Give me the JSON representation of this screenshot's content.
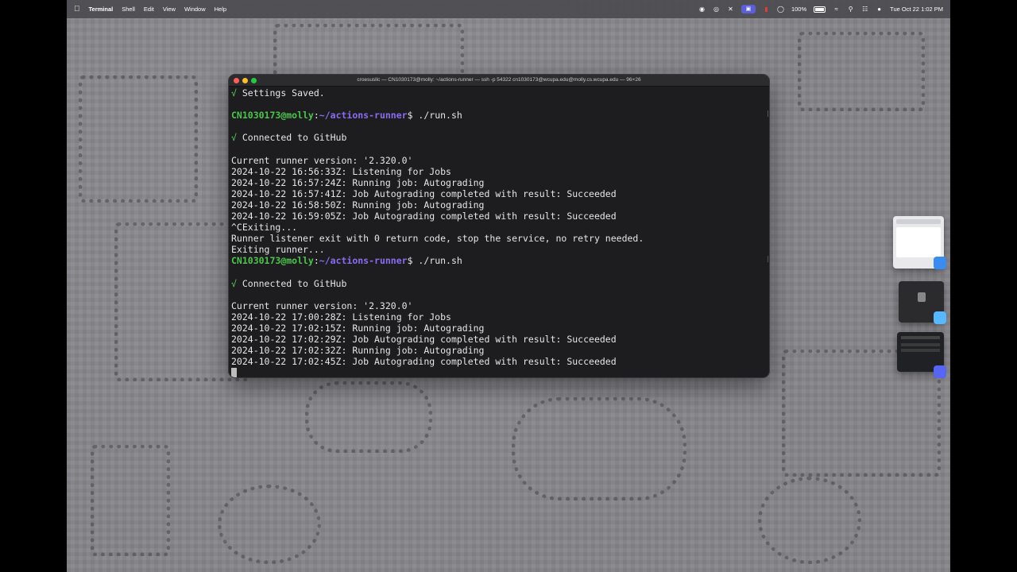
{
  "menubar": {
    "app": "Terminal",
    "items": [
      "Shell",
      "Edit",
      "View",
      "Window",
      "Help"
    ],
    "battery": "100%",
    "datetime": "Tue Oct 22  1:02 PM"
  },
  "terminal": {
    "title": "croesusllc — CN1030173@molly: ~/actions-runner — ssh -p 54322 cn1030173@wcupa.edu@molly.cs.wcupa.edu — 96×26",
    "prompt_user": "CN1030173@molly",
    "prompt_path": "~/actions-runner",
    "lines": [
      {
        "kind": "check",
        "text": "Settings Saved."
      },
      {
        "kind": "blank",
        "text": ""
      },
      {
        "kind": "prompt",
        "text": "$ ./run.sh"
      },
      {
        "kind": "blank",
        "text": ""
      },
      {
        "kind": "check",
        "text": "Connected to GitHub"
      },
      {
        "kind": "blank",
        "text": ""
      },
      {
        "kind": "plain",
        "text": "Current runner version: '2.320.0'"
      },
      {
        "kind": "plain",
        "text": "2024-10-22 16:56:33Z: Listening for Jobs"
      },
      {
        "kind": "plain",
        "text": "2024-10-22 16:57:24Z: Running job: Autograding"
      },
      {
        "kind": "plain",
        "text": "2024-10-22 16:57:41Z: Job Autograding completed with result: Succeeded"
      },
      {
        "kind": "plain",
        "text": "2024-10-22 16:58:50Z: Running job: Autograding"
      },
      {
        "kind": "plain",
        "text": "2024-10-22 16:59:05Z: Job Autograding completed with result: Succeeded"
      },
      {
        "kind": "plain",
        "text": "^CExiting..."
      },
      {
        "kind": "plain",
        "text": "Runner listener exit with 0 return code, stop the service, no retry needed."
      },
      {
        "kind": "plain",
        "text": "Exiting runner..."
      },
      {
        "kind": "prompt",
        "text": "$ ./run.sh"
      },
      {
        "kind": "blank",
        "text": ""
      },
      {
        "kind": "check",
        "text": "Connected to GitHub"
      },
      {
        "kind": "blank",
        "text": ""
      },
      {
        "kind": "plain",
        "text": "Current runner version: '2.320.0'"
      },
      {
        "kind": "plain",
        "text": "2024-10-22 17:00:28Z: Listening for Jobs"
      },
      {
        "kind": "plain",
        "text": "2024-10-22 17:02:15Z: Running job: Autograding"
      },
      {
        "kind": "plain",
        "text": "2024-10-22 17:02:29Z: Job Autograding completed with result: Succeeded"
      },
      {
        "kind": "plain",
        "text": "2024-10-22 17:02:32Z: Running job: Autograding"
      },
      {
        "kind": "plain",
        "text": "2024-10-22 17:02:45Z: Job Autograding completed with result: Succeeded"
      },
      {
        "kind": "cursor",
        "text": ""
      }
    ]
  },
  "stage_manager": {
    "windows": [
      {
        "app_icon": "safari-icon",
        "color": "#3b8cf0"
      },
      {
        "app_icon": "app-icon",
        "color": "#57b7ff"
      },
      {
        "app_icon": "discord-icon",
        "color": "#5865f2"
      }
    ]
  }
}
